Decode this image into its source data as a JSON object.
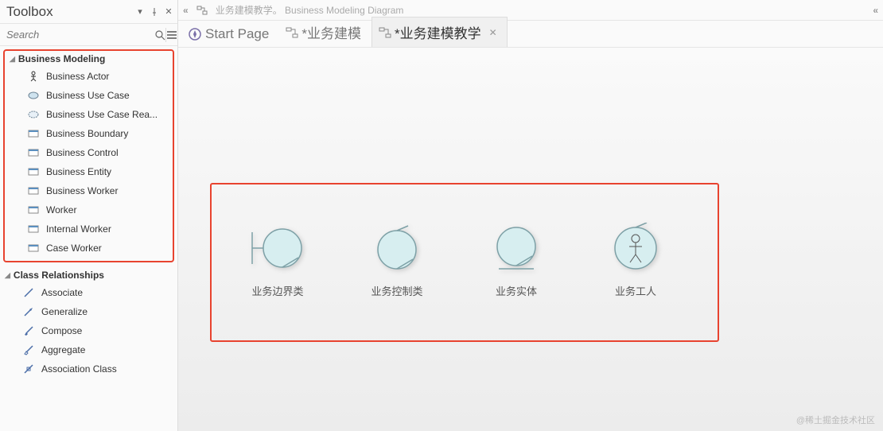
{
  "toolbox": {
    "title": "Toolbox",
    "search_placeholder": "Search",
    "groups": [
      {
        "name": "Business Modeling",
        "highlight": true,
        "items": [
          {
            "label": "Business Actor",
            "icon": "actor"
          },
          {
            "label": "Business Use Case",
            "icon": "oval"
          },
          {
            "label": "Business Use Case Rea...",
            "icon": "oval-dashed"
          },
          {
            "label": "Business Boundary",
            "icon": "rect"
          },
          {
            "label": "Business Control",
            "icon": "rect"
          },
          {
            "label": "Business Entity",
            "icon": "rect"
          },
          {
            "label": "Business Worker",
            "icon": "rect"
          },
          {
            "label": "Worker",
            "icon": "rect"
          },
          {
            "label": "Internal Worker",
            "icon": "rect"
          },
          {
            "label": "Case Worker",
            "icon": "rect"
          }
        ]
      },
      {
        "name": "Class Relationships",
        "highlight": false,
        "items": [
          {
            "label": "Associate",
            "icon": "line"
          },
          {
            "label": "Generalize",
            "icon": "arrow-tri"
          },
          {
            "label": "Compose",
            "icon": "arrow-dia"
          },
          {
            "label": "Aggregate",
            "icon": "arrow-dia-open"
          },
          {
            "label": "Association Class",
            "icon": "line-box"
          }
        ]
      }
    ]
  },
  "breadcrumb": {
    "text": "业务建模教学。 Business Modeling Diagram"
  },
  "tabs": [
    {
      "label": "Start Page",
      "icon": "compass",
      "modified": false,
      "active": false
    },
    {
      "label": "*业务建模",
      "icon": "diagram",
      "modified": true,
      "active": false
    },
    {
      "label": "*业务建模教学",
      "icon": "diagram",
      "modified": true,
      "active": true
    }
  ],
  "diagram_elements": [
    {
      "label": "业务边界类",
      "type": "boundary"
    },
    {
      "label": "业务控制类",
      "type": "control"
    },
    {
      "label": "业务实体",
      "type": "entity"
    },
    {
      "label": "业务工人",
      "type": "worker"
    }
  ],
  "watermark": "@稀土掘金技术社区"
}
